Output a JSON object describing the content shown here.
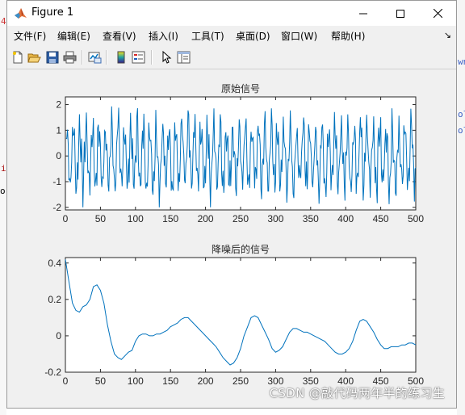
{
  "window": {
    "title": "Figure 1",
    "controls": {
      "minimize": "─",
      "maximize": "☐",
      "close": "✕"
    }
  },
  "menu": [
    "文件(F)",
    "编辑(E)",
    "查看(V)",
    "插入(I)",
    "工具(T)",
    "桌面(D)",
    "窗口(W)",
    "帮助(H)"
  ],
  "toolbar": {
    "icons": [
      "new-figure-icon",
      "open-file-icon",
      "save-icon",
      "print-icon",
      "link-plot-icon",
      "insert-colorbar-icon",
      "insert-legend-icon",
      "pointer-icon",
      "property-inspector-icon"
    ]
  },
  "background_fragments": {
    "left": [
      "4",
      "i",
      "o"
    ],
    "right": [
      "wn",
      "ol",
      "ol"
    ]
  },
  "colors": {
    "series": "#0072bd",
    "axes_bg": "#ffffff",
    "figure_bg": "#f0f0f0"
  },
  "chart_data": [
    {
      "type": "line",
      "title": "原始信号",
      "xlim": [
        0,
        500
      ],
      "ylim": [
        -2.1,
        2.3
      ],
      "xticks": [
        0,
        50,
        100,
        150,
        200,
        250,
        300,
        350,
        400,
        450,
        500
      ],
      "yticks": [
        -2,
        -1,
        0,
        1,
        2
      ],
      "grid": false,
      "series": [
        {
          "style": "noisy oscillation around 0, ~55 cycles over 500 samples",
          "x_range": [
            1,
            500
          ],
          "approx_min": -2.0,
          "approx_max": 2.3
        }
      ]
    },
    {
      "type": "line",
      "title": "降噪后的信号",
      "xlim": [
        0,
        500
      ],
      "ylim": [
        -0.2,
        0.43
      ],
      "xticks": [
        0,
        50,
        100,
        150,
        200,
        250,
        300,
        350,
        400,
        450,
        500
      ],
      "yticks": [
        -0.2,
        0,
        0.2,
        0.4
      ],
      "grid": false,
      "series": [
        {
          "x": [
            0,
            5,
            10,
            15,
            20,
            25,
            30,
            35,
            40,
            45,
            50,
            55,
            60,
            65,
            70,
            75,
            80,
            85,
            90,
            95,
            100,
            105,
            110,
            115,
            120,
            125,
            130,
            135,
            140,
            145,
            150,
            155,
            160,
            165,
            170,
            175,
            180,
            185,
            190,
            195,
            200,
            205,
            210,
            215,
            220,
            225,
            230,
            235,
            240,
            245,
            250,
            255,
            260,
            265,
            270,
            275,
            280,
            285,
            290,
            295,
            300,
            305,
            310,
            315,
            320,
            325,
            330,
            335,
            340,
            345,
            350,
            355,
            360,
            365,
            370,
            375,
            380,
            385,
            390,
            395,
            400,
            405,
            410,
            415,
            420,
            425,
            430,
            435,
            440,
            445,
            450,
            455,
            460,
            465,
            470,
            475,
            480,
            485,
            490,
            495,
            500
          ],
          "y": [
            0.42,
            0.3,
            0.18,
            0.14,
            0.13,
            0.16,
            0.17,
            0.2,
            0.27,
            0.28,
            0.25,
            0.18,
            0.06,
            -0.03,
            -0.1,
            -0.12,
            -0.13,
            -0.11,
            -0.09,
            -0.08,
            -0.03,
            0.0,
            0.01,
            0.01,
            0.0,
            0.0,
            0.01,
            0.01,
            0.02,
            0.03,
            0.05,
            0.06,
            0.07,
            0.09,
            0.1,
            0.1,
            0.08,
            0.06,
            0.04,
            0.02,
            0.0,
            -0.02,
            -0.04,
            -0.06,
            -0.09,
            -0.12,
            -0.14,
            -0.16,
            -0.15,
            -0.12,
            -0.07,
            0.0,
            0.05,
            0.1,
            0.11,
            0.1,
            0.06,
            0.02,
            -0.02,
            -0.07,
            -0.09,
            -0.08,
            -0.06,
            -0.02,
            0.02,
            0.04,
            0.04,
            0.03,
            0.02,
            0.02,
            0.01,
            0.0,
            -0.01,
            -0.02,
            -0.03,
            -0.05,
            -0.07,
            -0.09,
            -0.1,
            -0.1,
            -0.09,
            -0.07,
            -0.03,
            0.03,
            0.08,
            0.09,
            0.08,
            0.05,
            0.02,
            -0.02,
            -0.05,
            -0.07,
            -0.07,
            -0.06,
            -0.06,
            -0.06,
            -0.05,
            -0.05,
            -0.04,
            -0.04,
            -0.05
          ]
        }
      ]
    }
  ],
  "watermark": "CSDN @敲代码两年半的练习生"
}
